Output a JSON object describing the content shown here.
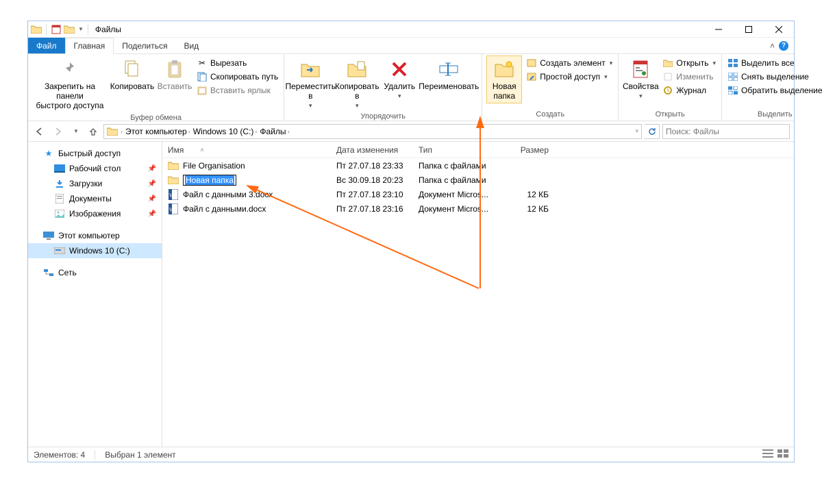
{
  "window": {
    "title": "Файлы"
  },
  "tabs": {
    "file": "Файл",
    "home": "Главная",
    "share": "Поделиться",
    "view": "Вид"
  },
  "ribbon": {
    "clipboard": {
      "group": "Буфер обмена",
      "pin": "Закрепить на панели\nбыстрого доступа",
      "copy": "Копировать",
      "paste": "Вставить",
      "cut": "Вырезать",
      "copy_path": "Скопировать путь",
      "paste_shortcut": "Вставить ярлык"
    },
    "organize": {
      "group": "Упорядочить",
      "move_to": "Переместить\nв",
      "copy_to": "Копировать\nв",
      "delete": "Удалить",
      "rename": "Переименовать"
    },
    "new": {
      "group": "Создать",
      "new_folder": "Новая\nпапка",
      "new_item": "Создать элемент",
      "easy_access": "Простой доступ"
    },
    "open": {
      "group": "Открыть",
      "properties": "Свойства",
      "open": "Открыть",
      "edit": "Изменить",
      "history": "Журнал"
    },
    "select": {
      "group": "Выделить",
      "select_all": "Выделить все",
      "select_none": "Снять выделение",
      "invert": "Обратить выделение"
    }
  },
  "address": {
    "crumbs": [
      "Этот компьютер",
      "Windows 10 (C:)",
      "Файлы"
    ]
  },
  "search": {
    "placeholder": "Поиск: Файлы"
  },
  "columns": {
    "name": "Имя",
    "date": "Дата изменения",
    "type": "Тип",
    "size": "Размер"
  },
  "sidebar": {
    "quick_access": "Быстрый доступ",
    "desktop": "Рабочий стол",
    "downloads": "Загрузки",
    "documents": "Документы",
    "pictures": "Изображения",
    "this_pc": "Этот компьютер",
    "drive_c": "Windows 10 (C:)",
    "network": "Сеть"
  },
  "files": [
    {
      "icon": "folder",
      "name": "File Organisation",
      "date": "Пт 27.07.18 23:33",
      "type": "Папка с файлами",
      "size": ""
    },
    {
      "icon": "folder",
      "name": "Новая папка",
      "date": "Вс 30.09.18 20:23",
      "type": "Папка с файлами",
      "size": "",
      "renaming": true
    },
    {
      "icon": "word",
      "name": "Файл с данными 3.docx",
      "date": "Пт 27.07.18 23:10",
      "type": "Документ Micros...",
      "size": "12 КБ"
    },
    {
      "icon": "word",
      "name": "Файл с данными.docx",
      "date": "Пт 27.07.18 23:16",
      "type": "Документ Micros...",
      "size": "12 КБ"
    }
  ],
  "status": {
    "count": "Элементов: 4",
    "selection": "Выбран 1 элемент"
  }
}
